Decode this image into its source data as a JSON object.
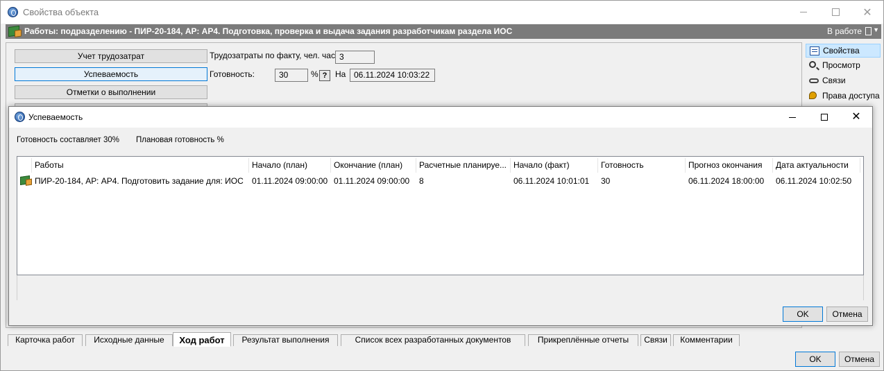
{
  "window": {
    "title": "Свойства объекта"
  },
  "header": {
    "title": "Работы: подразделению - ПИР-20-184, АР: АР4. Подготовка, проверка и выдача задания разработчикам раздела ИОС",
    "status": "В работе",
    "arrow": "▼"
  },
  "side_buttons": {
    "labor": "Учет трудозатрат",
    "progress": "Успеваемость",
    "completion": "Отметки о выполнении"
  },
  "fields": {
    "labor_label": "Трудозатраты по факту, чел. час",
    "labor_value": "3",
    "ready_label": "Готовность:",
    "ready_value": "30",
    "percent_sign": "%",
    "help": "?",
    "on_label": "На",
    "date_value": "06.11.2024 10:03:22"
  },
  "right_panel": {
    "items": [
      "Свойства",
      "Просмотр",
      "Связи",
      "Права доступа"
    ]
  },
  "tabs": [
    "Карточка работ",
    "Исходные данные",
    "Ход работ",
    "Результат выполнения",
    "Список всех разработанных документов",
    "Прикреплённые отчеты",
    "Связи",
    "Комментарии"
  ],
  "main_buttons": {
    "ok": "OK",
    "cancel": "Отмена"
  },
  "dialog": {
    "title": "Успеваемость",
    "info_ready": "Готовность составляет 30%",
    "info_planned": "Плановая готовность %",
    "columns": [
      "Работы",
      "Начало (план)",
      "Окончание (план)",
      "Расчетные планируе...",
      "Начало (факт)",
      "Готовность",
      "Прогноз окончания",
      "Дата актуальности"
    ],
    "rows": [
      [
        "ПИР-20-184, АР: АР4. Подготовить задание для: ИОС",
        "01.11.2024 09:00:00",
        "01.11.2024 09:00:00",
        "8",
        "06.11.2024 10:01:01",
        "30",
        "06.11.2024 18:00:00",
        "06.11.2024 10:02:50"
      ]
    ],
    "ok": "OK",
    "cancel": "Отмена"
  }
}
